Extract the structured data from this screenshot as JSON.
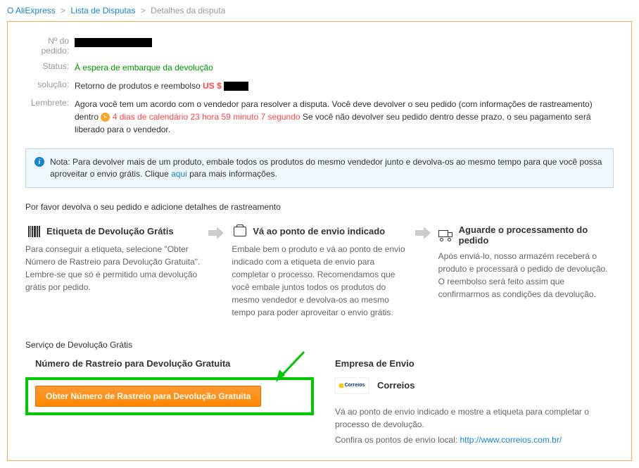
{
  "breadcrumb": {
    "item1": "O AliExpress",
    "item2": "Lista de Disputas",
    "current": "Detalhes da disputa"
  },
  "info": {
    "order_label": "Nº do pedido:",
    "status_label": "Status:",
    "status_value": "À espera de embarque da devolução",
    "solution_label": "solução:",
    "solution_value": "Retorno de produtos e reembolso ",
    "currency": "US $ ",
    "reminder_label": "Lembrete:",
    "reminder_text1": "Agora você tem um acordo com o vendedor para resolver a disputa. Você deve devolver o seu pedido (com informações de rastreamento) dentro ",
    "countdown": "4 dias de calendário 23 hora 59 minuto 7 segundo",
    "reminder_text2": " Se você não devolver seu pedido dentro desse prazo, o seu pagamento será liberado para o vendedor."
  },
  "note": {
    "prefix": "Nota: ",
    "text1": "Para devolver mais de um produto, embale todos os produtos do mesmo vendedor junto e devolva-os ao mesmo tempo para que você possa aproveitar o envio grátis. Clique ",
    "link_text": "aqui",
    "text2": " para mais informações."
  },
  "return_instruction": "Por favor devolva o seu pedido e adicione detalhes de rastreamento",
  "steps": {
    "step1_title": "Etiqueta de Devolução Grátis",
    "step1_desc": "Para conseguir a etiqueta, selecione \"Obter Número de Rastreio para Devolução Gratuita\". Lembre-se que só é permitido uma devolução grátis por pedido.",
    "step2_title": "Vá ao ponto de envio indicado",
    "step2_desc": "Embale bem o produto e vá ao ponto de envio indicado com a etiqueta de envio para completar o processo. Recomendamos que você embale juntos todos os produtos do mesmo vendedor e devolva-os ao mesmo tempo para poder aproveitar o envio grátis.",
    "step3_title": "Aguarde o processamento do pedido",
    "step3_desc": "Após enviá-lo, nosso armazém receberá o produto e processará o pedido de devolução. O reembolso será feito assim que confirmarmos as condições da devolução."
  },
  "free_return_section": "Serviço de Devolução Grátis",
  "tracking": {
    "left_header": "Número de Rastreio para Devolução Gratuita",
    "button_label": "Obter Número de Rastreio para Devolução Gratuita",
    "right_header": "Empresa de Envio",
    "company_name": "Correios",
    "instruction1": "Vá ao ponto de envio indicado e mostre a etiqueta para completar o processo de devolução.",
    "instruction2": "Confira os pontos de envio local: ",
    "correios_url": "http://www.correios.com.br/"
  }
}
